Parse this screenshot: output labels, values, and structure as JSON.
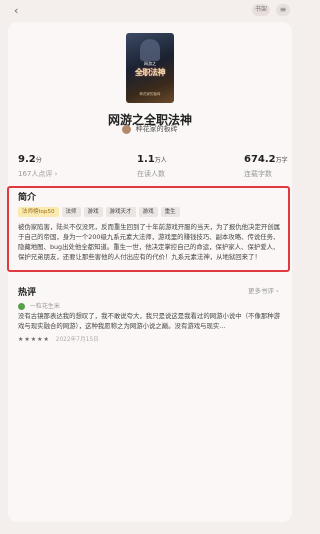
{
  "topbar": {
    "back_icon": "chevron-left-icon",
    "shelf_label": "书架",
    "menu_icon": "menu-icon"
  },
  "book": {
    "title": "网游之全职法神",
    "author": "种花家的板砖",
    "cover_title": "全职法神",
    "cover_subtitle": "网游之",
    "cover_author": "种花家的板砖"
  },
  "stats": [
    {
      "value": "9.2",
      "unit": "分",
      "label": "167人点评 ›"
    },
    {
      "value": "1.1",
      "unit": "万人",
      "label": "在读人数"
    },
    {
      "value": "674.2",
      "unit": "万字",
      "label": "连载字数"
    }
  ],
  "intro": {
    "heading": "简介",
    "tags": [
      "法师榜top50",
      "法师",
      "游戏",
      "游戏天才",
      "游戏",
      "重生"
    ],
    "synopsis": "被伪家陷害，陆炎不仅没死，反而重生回到了十年前游戏开服的当天，为了报仇他决定开创属于自己的帝国，身为一个200级九系元素大法师，游戏里的赚钱技巧、副本攻略、传说任务、隐藏地图、bug出处他全都知道。重生一世，他决定掌控自己的命运，保护家人、保护爱人、保护兄弟朋友，还要让那些害他的人付出应有的代价！九系元素法神，从地狱回来了！"
  },
  "reviews": {
    "heading": "热评",
    "more_label": "更多书评 ›",
    "items": [
      {
        "user": "一粒花生米",
        "text": "没有古镜那表达我的想叹了，我不敢说夸大，我只是说这是我看过的网游小说中（不像那种游戏与现实融合的网游），这种我愿称之为网游小说之巅。没有游戏与现实...",
        "stars": "★★★★★",
        "date": "2022年7月15日"
      }
    ]
  }
}
